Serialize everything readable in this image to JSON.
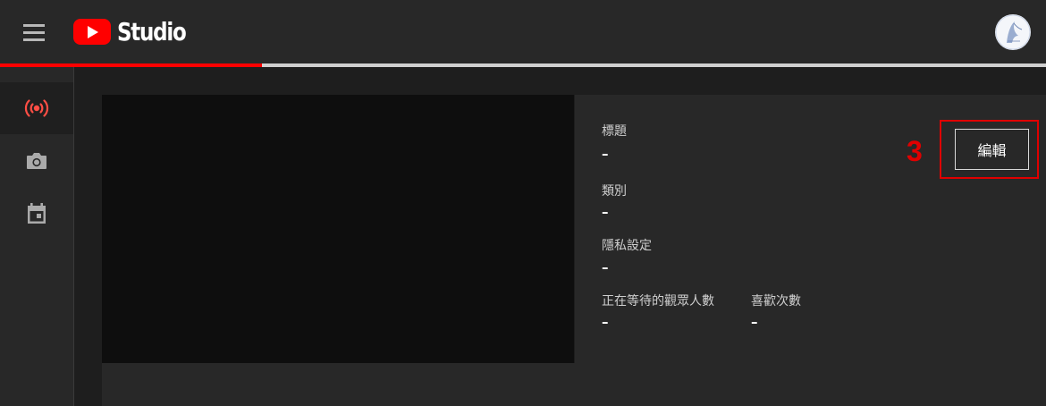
{
  "app": {
    "logo_text": "Studio",
    "menu_icon": "hamburger-menu-icon",
    "avatar_icon": "user-avatar-icon"
  },
  "colors": {
    "brand_red": "#ff0000",
    "annotation_red": "#e00000",
    "topbar": "#282828",
    "sidebar": "#282828",
    "panel": "#282828",
    "preview": "#0e0e0e"
  },
  "progress": {
    "percent": 25
  },
  "sidebar": {
    "items": [
      {
        "icon": "live-broadcast-icon",
        "active": true
      },
      {
        "icon": "camera-icon",
        "active": false
      },
      {
        "icon": "calendar-icon",
        "active": false
      }
    ]
  },
  "stream_info": {
    "title_label": "標題",
    "title_value": "–",
    "category_label": "類別",
    "category_value": "–",
    "privacy_label": "隱私設定",
    "privacy_value": "–",
    "waiting_viewers_label": "正在等待的觀眾人數",
    "waiting_viewers_value": "–",
    "likes_label": "喜歡次數",
    "likes_value": "–"
  },
  "annotation": {
    "step_number": "3"
  },
  "edit_button": {
    "label": "編輯"
  }
}
